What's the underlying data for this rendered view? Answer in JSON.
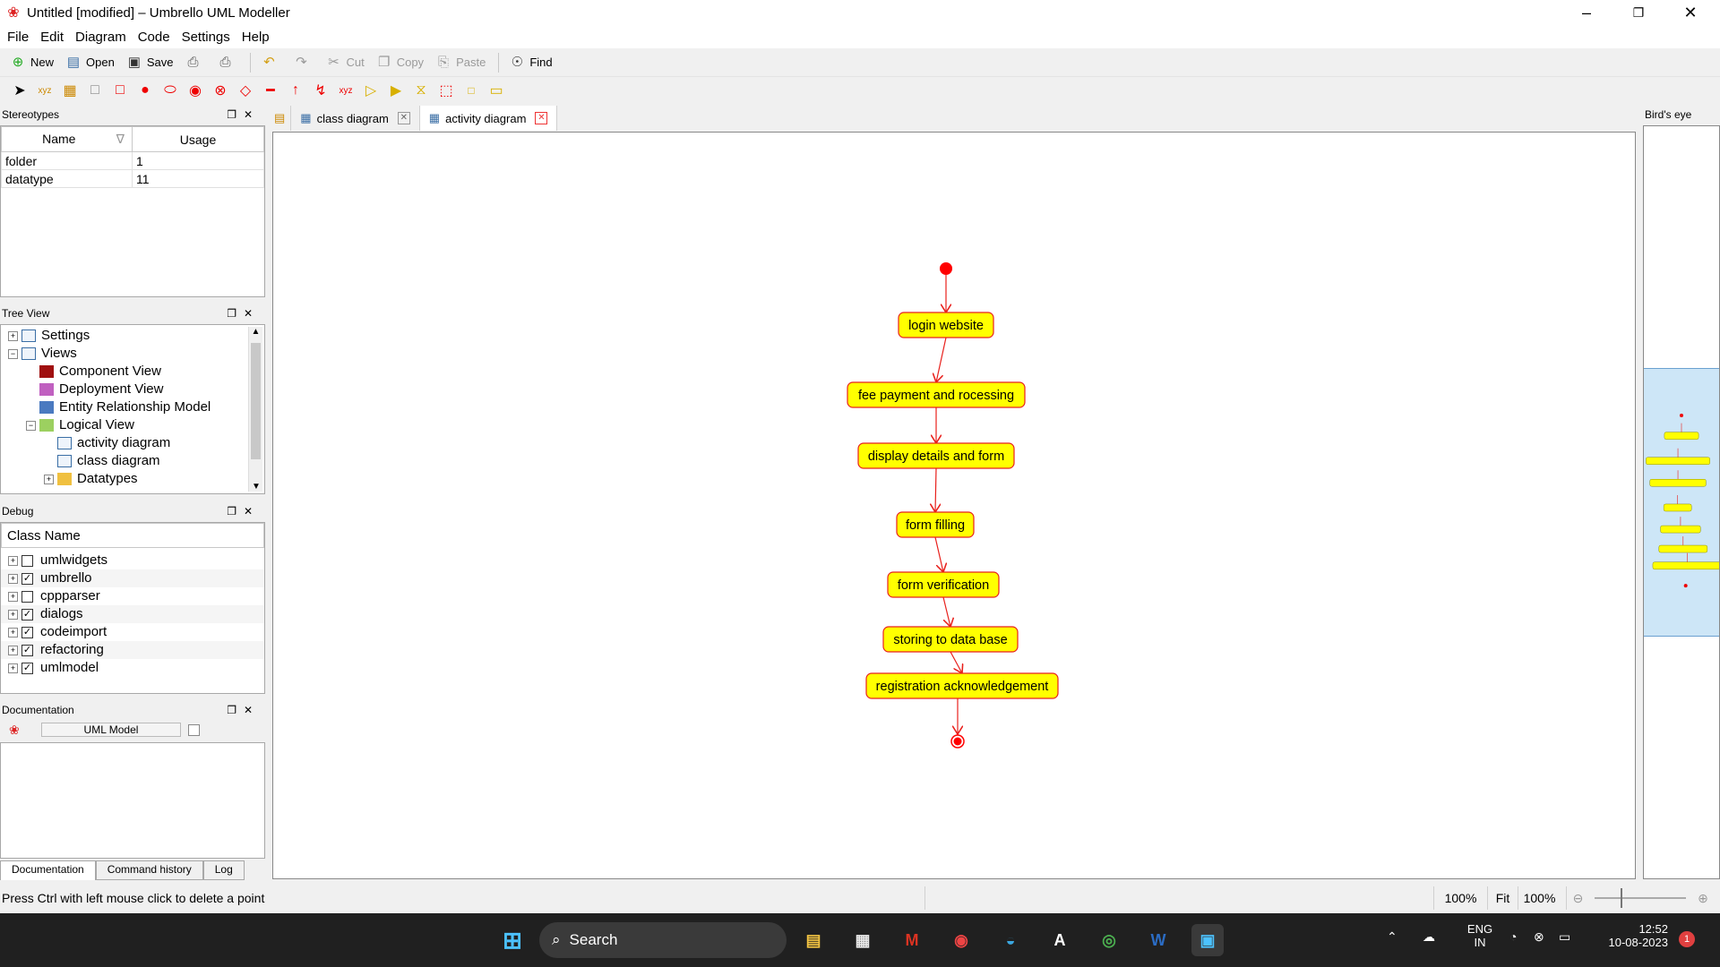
{
  "window": {
    "title": "Untitled [modified] – Umbrello UML Modeller"
  },
  "menu": [
    "File",
    "Edit",
    "Diagram",
    "Code",
    "Settings",
    "Help"
  ],
  "toolbar": {
    "new": "New",
    "open": "Open",
    "save": "Save",
    "cut": "Cut",
    "copy": "Copy",
    "paste": "Paste",
    "find": "Find"
  },
  "stereotypes": {
    "title": "Stereotypes",
    "columns": [
      "Name",
      "Usage"
    ],
    "rows": [
      {
        "name": "folder",
        "usage": "1"
      },
      {
        "name": "datatype",
        "usage": "11"
      }
    ]
  },
  "tree_view": {
    "title": "Tree View",
    "items": [
      {
        "label": "Settings",
        "level": 0,
        "icon": "settings-icon"
      },
      {
        "label": "Views",
        "level": 0,
        "icon": "views-icon"
      },
      {
        "label": "Component View",
        "level": 1,
        "icon": "component-view-icon",
        "color": "#a01010"
      },
      {
        "label": "Deployment View",
        "level": 1,
        "icon": "deployment-view-icon",
        "color": "#c060c0"
      },
      {
        "label": "Entity Relationship Model",
        "level": 1,
        "icon": "er-model-icon",
        "color": "#4a7ac0"
      },
      {
        "label": "Logical View",
        "level": 1,
        "icon": "logical-view-icon",
        "color": "#9cd060"
      },
      {
        "label": "activity diagram",
        "level": 2,
        "icon": "diagram-icon"
      },
      {
        "label": "class diagram",
        "level": 2,
        "icon": "diagram-icon"
      },
      {
        "label": "Datatypes",
        "level": 2,
        "icon": "folder-icon",
        "color": "#f0c040"
      }
    ]
  },
  "debug": {
    "title": "Debug",
    "column": "Class Name",
    "items": [
      {
        "label": "umlwidgets",
        "checked": false
      },
      {
        "label": "umbrello",
        "checked": true
      },
      {
        "label": "cppparser",
        "checked": false
      },
      {
        "label": "dialogs",
        "checked": true
      },
      {
        "label": "codeimport",
        "checked": true
      },
      {
        "label": "refactoring",
        "checked": true
      },
      {
        "label": "umlmodel",
        "checked": true
      }
    ]
  },
  "documentation": {
    "title": "Documentation",
    "field": "UML Model",
    "tabs": [
      "Documentation",
      "Command history",
      "Log"
    ]
  },
  "tabs": [
    "class diagram",
    "activity diagram"
  ],
  "activities": [
    "login website",
    "fee payment and rocessing",
    "display details and form",
    "form filling",
    "form verification",
    "storing to data base",
    "registration acknowledgement"
  ],
  "birdseye": {
    "title": "Bird's eye"
  },
  "status": {
    "message": "Press Ctrl with left mouse click to delete a point",
    "zoom1": "100%",
    "fit": "Fit",
    "zoom2": "100%"
  },
  "taskbar": {
    "search": "Search",
    "lang": "ENG",
    "region": "IN",
    "time": "12:52",
    "date": "10-08-2023",
    "badge": "1"
  },
  "colors": {
    "activity_fill": "#ffff00",
    "activity_border": "#e8201c",
    "flow": "#e8201c"
  }
}
